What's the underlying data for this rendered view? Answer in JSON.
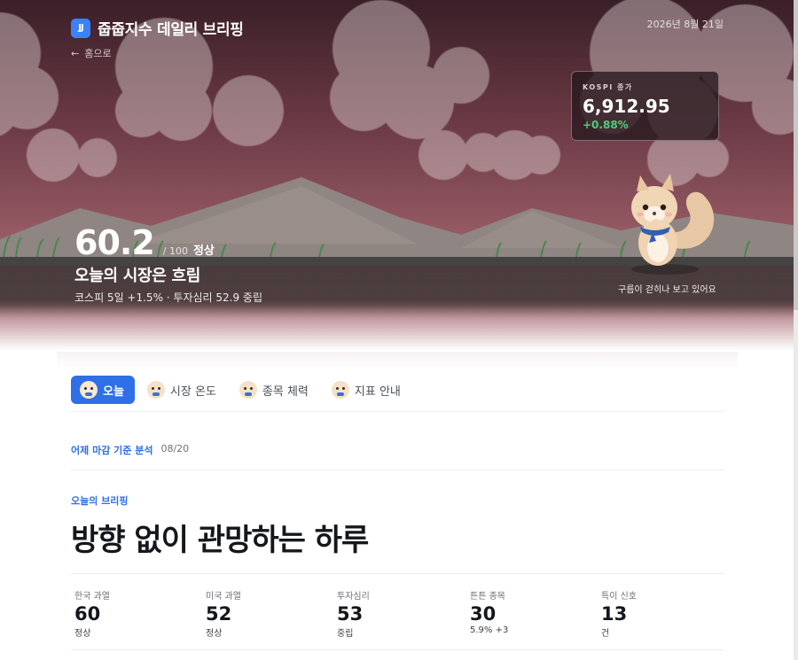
{
  "header": {
    "logo_text": "JJ",
    "title": "줍줍지수 데일리 브리핑",
    "back_label": "홈으로",
    "date": "2026년 8월 21일"
  },
  "kospi": {
    "label": "KOSPI 종가",
    "value": "6,912.95",
    "change": "+0.88%"
  },
  "hero": {
    "score": "60.2",
    "score_max": "/ 100",
    "score_status": "정상",
    "headline": "오늘의 시장은 흐림",
    "subline": "코스피 5일 +1.5% · 투자심리 52.9 중립",
    "mascot_caption": "구름이 걷히나 보고 있어요"
  },
  "tabs": [
    {
      "label": "오늘",
      "active": true
    },
    {
      "label": "시장 온도",
      "active": false
    },
    {
      "label": "종목 체력",
      "active": false
    },
    {
      "label": "지표 안내",
      "active": false
    }
  ],
  "analysis": {
    "label": "어제 마감 기준 분석",
    "date": "08/20"
  },
  "briefing": {
    "label": "오늘의 브리핑",
    "title": "방향 없이 관망하는 하루"
  },
  "stats": [
    {
      "label": "한국 과열",
      "value": "60",
      "sub": "정상"
    },
    {
      "label": "미국 과열",
      "value": "52",
      "sub": "정상"
    },
    {
      "label": "투자심리",
      "value": "53",
      "sub": "중립"
    },
    {
      "label": "튼튼 종목",
      "value": "30",
      "sub": "5.9% +3"
    },
    {
      "label": "특이 신호",
      "value": "13",
      "sub": "건"
    }
  ],
  "colors": {
    "accent": "#2f6fe7",
    "positive": "#47d17a",
    "sky_top": "#3a1f28",
    "sky_bottom": "#a86a74"
  }
}
